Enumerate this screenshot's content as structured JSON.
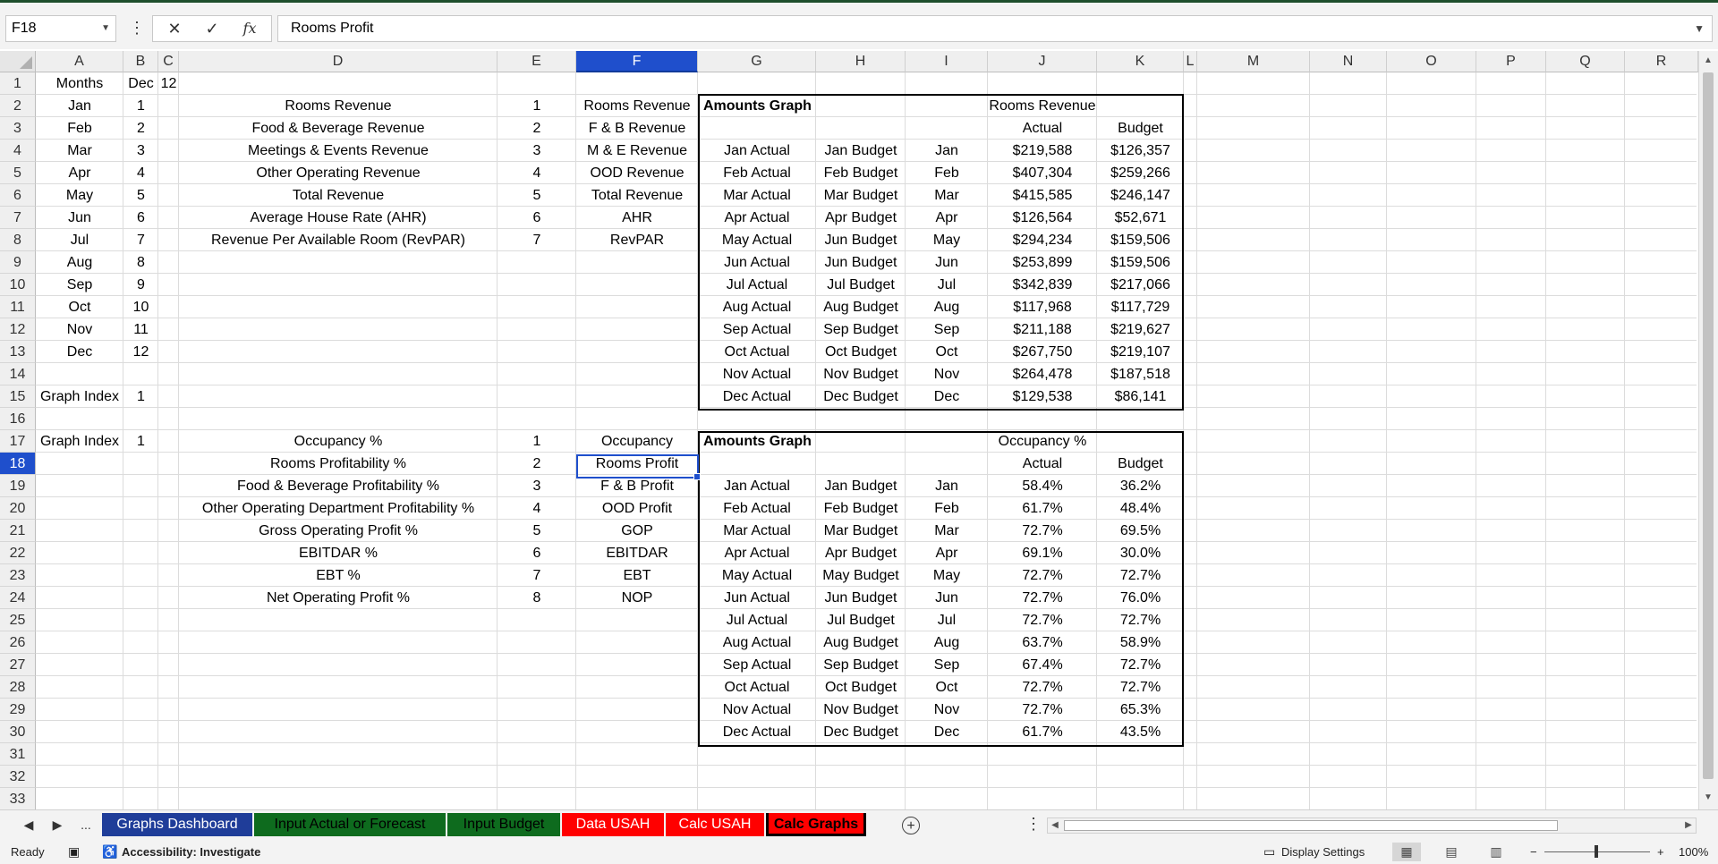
{
  "formula_bar": {
    "name_box": "F18",
    "cancel_icon": "✕",
    "enter_icon": "✓",
    "fx_icon": "fx",
    "formula": "Rooms Profit"
  },
  "columns": [
    "A",
    "B",
    "C",
    "D",
    "E",
    "F",
    "G",
    "H",
    "I",
    "J",
    "K",
    "L",
    "M",
    "N",
    "O",
    "P",
    "Q",
    "R"
  ],
  "selected_column": "F",
  "rows": [
    "1",
    "2",
    "3",
    "4",
    "5",
    "6",
    "7",
    "8",
    "9",
    "10",
    "11",
    "12",
    "13",
    "14",
    "15",
    "16",
    "17",
    "18",
    "19",
    "20",
    "21",
    "22",
    "23",
    "24",
    "25",
    "26",
    "27",
    "28",
    "29",
    "30",
    "31",
    "32",
    "33"
  ],
  "selected_row": "18",
  "sheet": {
    "months_header": "Months",
    "b1": "Dec",
    "c1": "12",
    "months": [
      "Jan",
      "Feb",
      "Mar",
      "Apr",
      "May",
      "Jun",
      "Jul",
      "Aug",
      "Sep",
      "Oct",
      "Nov",
      "Dec"
    ],
    "month_numbers": [
      "1",
      "2",
      "3",
      "4",
      "5",
      "6",
      "7",
      "8",
      "9",
      "10",
      "11",
      "12"
    ],
    "graph_index_label": "Graph Index",
    "graph_index_1": "1",
    "graph_index_2": "1",
    "revenue_items": [
      "Rooms Revenue",
      "Food & Beverage Revenue",
      "Meetings & Events Revenue",
      "Other Operating Revenue",
      "Total Revenue",
      "Average House Rate (AHR)",
      "Revenue Per Available Room (RevPAR)"
    ],
    "revenue_numbers": [
      "1",
      "2",
      "3",
      "4",
      "5",
      "6",
      "7"
    ],
    "revenue_short": [
      "Rooms Revenue",
      "F & B Revenue",
      "M & E Revenue",
      "OOD Revenue",
      "Total Revenue",
      "AHR",
      "RevPAR"
    ],
    "profit_items": [
      "Occupancy %",
      "Rooms Profitability %",
      "Food & Beverage Profitability %",
      "Other Operating Department Profitability %",
      "Gross Operating Profit %",
      "EBITDAR %",
      "EBT %",
      "Net Operating Profit %"
    ],
    "profit_numbers": [
      "1",
      "2",
      "3",
      "4",
      "5",
      "6",
      "7",
      "8"
    ],
    "profit_short": [
      "Occupancy",
      "Rooms Profit",
      "F & B Profit",
      "OOD Profit",
      "GOP",
      "EBITDAR",
      "EBT",
      "NOP"
    ],
    "table1": {
      "title": "Amounts Graph",
      "metric": "Rooms Revenue",
      "actual_header": "Actual",
      "budget_header": "Budget",
      "actual_labels": [
        "Jan Actual",
        "Feb Actual",
        "Mar Actual",
        "Apr Actual",
        "May Actual",
        "Jun Actual",
        "Jul Actual",
        "Aug Actual",
        "Sep Actual",
        "Oct Actual",
        "Nov Actual",
        "Dec Actual"
      ],
      "budget_labels": [
        "Jan Budget",
        "Feb Budget",
        "Mar Budget",
        "Apr Budget",
        "Jun Budget",
        "Jun Budget",
        "Jul Budget",
        "Aug Budget",
        "Sep Budget",
        "Oct Budget",
        "Nov Budget",
        "Dec Budget"
      ],
      "months": [
        "Jan",
        "Feb",
        "Mar",
        "Apr",
        "May",
        "Jun",
        "Jul",
        "Aug",
        "Sep",
        "Oct",
        "Nov",
        "Dec"
      ],
      "actual": [
        "$219,588",
        "$407,304",
        "$415,585",
        "$126,564",
        "$294,234",
        "$253,899",
        "$342,839",
        "$117,968",
        "$211,188",
        "$267,750",
        "$264,478",
        "$129,538"
      ],
      "budget": [
        "$126,357",
        "$259,266",
        "$246,147",
        "$52,671",
        "$159,506",
        "$159,506",
        "$217,066",
        "$117,729",
        "$219,627",
        "$219,107",
        "$187,518",
        "$86,141"
      ]
    },
    "table2": {
      "title": "Amounts Graph",
      "metric": "Occupancy %",
      "actual_header": "Actual",
      "budget_header": "Budget",
      "actual_labels": [
        "Jan Actual",
        "Feb Actual",
        "Mar Actual",
        "Apr Actual",
        "May Actual",
        "Jun Actual",
        "Jul Actual",
        "Aug Actual",
        "Sep Actual",
        "Oct Actual",
        "Nov Actual",
        "Dec Actual"
      ],
      "budget_labels": [
        "Jan Budget",
        "Feb Budget",
        "Mar Budget",
        "Apr Budget",
        "May Budget",
        "Jun Budget",
        "Jul Budget",
        "Aug Budget",
        "Sep Budget",
        "Oct Budget",
        "Nov Budget",
        "Dec Budget"
      ],
      "months": [
        "Jan",
        "Feb",
        "Mar",
        "Apr",
        "May",
        "Jun",
        "Jul",
        "Aug",
        "Sep",
        "Oct",
        "Nov",
        "Dec"
      ],
      "actual": [
        "58.4%",
        "61.7%",
        "72.7%",
        "69.1%",
        "72.7%",
        "72.7%",
        "72.7%",
        "63.7%",
        "67.4%",
        "72.7%",
        "72.7%",
        "61.7%"
      ],
      "budget": [
        "36.2%",
        "48.4%",
        "69.5%",
        "30.0%",
        "72.7%",
        "76.0%",
        "72.7%",
        "58.9%",
        "72.7%",
        "72.7%",
        "65.3%",
        "43.5%"
      ]
    }
  },
  "tabs": [
    {
      "label": "Graphs Dashboard",
      "color": "#1f3d99",
      "text_color": "#ffffff",
      "active": false
    },
    {
      "label": "Input Actual or Forecast",
      "color": "#0e6b1e",
      "text_color": "#000000",
      "active": false
    },
    {
      "label": "Input Budget",
      "color": "#0e6b1e",
      "text_color": "#000000",
      "active": false
    },
    {
      "label": "Data USAH",
      "color": "#ff0000",
      "text_color": "#ffffff",
      "active": false
    },
    {
      "label": "Calc USAH",
      "color": "#ff0000",
      "text_color": "#ffffff",
      "active": false
    },
    {
      "label": "Calc Graphs",
      "color": "#ff0000",
      "text_color": "#000000",
      "active": true
    }
  ],
  "tab_nav": {
    "prev": "◀",
    "next": "▶",
    "more": "..."
  },
  "status": {
    "ready": "Ready",
    "accessibility": "Accessibility: Investigate",
    "display_settings": "Display Settings",
    "zoom": "100%",
    "zoom_level": 1.0
  },
  "colors": {
    "accent": "#1f4fcc",
    "header_bg": "#efefef",
    "title_bar": "#1e4e2c"
  }
}
